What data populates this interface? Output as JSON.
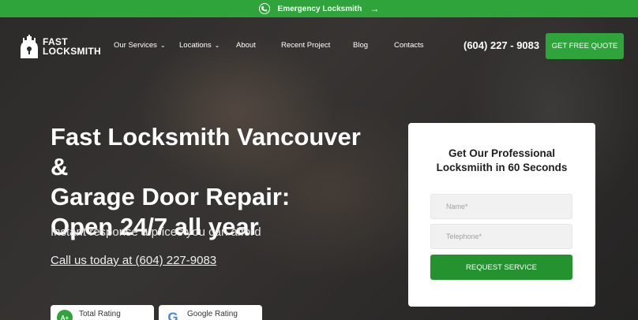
{
  "topbar": {
    "icon": "phone-24-icon",
    "label": "Emergency Locksmith",
    "arrow": "→"
  },
  "header": {
    "logo_line1": "FAST",
    "logo_line2": "LOCKSMITH",
    "nav": [
      {
        "label": "Our Services",
        "has_dropdown": true
      },
      {
        "label": "Locations",
        "has_dropdown": true
      },
      {
        "label": "About",
        "has_dropdown": false
      },
      {
        "label": "Recent Project",
        "has_dropdown": false
      },
      {
        "label": "Blog",
        "has_dropdown": false
      },
      {
        "label": "Contacts",
        "has_dropdown": false
      }
    ],
    "chevron": "⌄",
    "phone": "(604) 227 - 9083",
    "cta": "GET FREE QUOTE"
  },
  "hero": {
    "headline_1": "Fast Locksmith Vancouver &",
    "headline_2": "Garage Door Repair:",
    "headline_3": "Open 24/7 all year",
    "subline": "Instant response a prices you can afford",
    "call_link": "Call us today at (604) 227-9083"
  },
  "ratings": [
    {
      "badge": "A+",
      "label": "Total Rating"
    },
    {
      "badge": "G",
      "label": "Google Rating"
    }
  ],
  "form": {
    "title_1": "Get Our Professional",
    "title_2": "Locksmiith in 60 Seconds",
    "name_placeholder": "Name*",
    "phone_placeholder": "Telephone*",
    "submit": "REQUEST SERVICE"
  },
  "colors": {
    "brand_green": "#2ea43a",
    "button_green": "#24922f"
  }
}
